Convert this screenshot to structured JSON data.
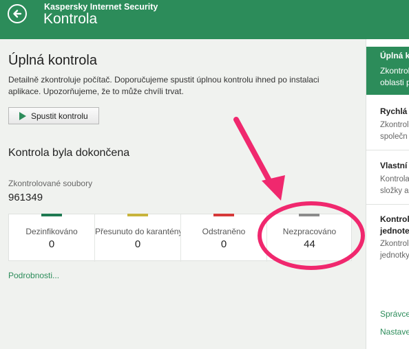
{
  "header": {
    "app_name": "Kaspersky Internet Security",
    "title": "Kontrola"
  },
  "main": {
    "heading": "Úplná kontrola",
    "description": "Detailně zkontroluje počítač. Doporučujeme spustit úplnou kontrolu ihned po instalaci aplikace. Upozorňujeme, že to může chvíli trvat.",
    "run_button": "Spustit kontrolu",
    "status_heading": "Kontrola byla dokončena",
    "files_label": "Zkontrolované soubory",
    "files_value": "961349",
    "stats": [
      {
        "label": "Dezinfikováno",
        "value": "0",
        "color": "#1f7a52"
      },
      {
        "label": "Přesunuto do karantény",
        "value": "0",
        "color": "#c8b43c"
      },
      {
        "label": "Odstraněno",
        "value": "0",
        "color": "#d63a3a"
      },
      {
        "label": "Nezpracováno",
        "value": "44",
        "color": "#8c8c8c"
      }
    ],
    "details_link": "Podrobnosti..."
  },
  "sidebar": {
    "active": {
      "title": "Úplná k",
      "desc_line1": "Zkontrol",
      "desc_line2": "oblasti p"
    },
    "items": [
      {
        "title": "Rychlá k",
        "desc_line1": "Zkontrol",
        "desc_line2": "společn"
      },
      {
        "title": "Vlastní k",
        "desc_line1": "Kontrola",
        "desc_line2": "složky a"
      },
      {
        "title_line1": "Kontrola",
        "title_line2": "jednote",
        "desc_line1": "Zkontrol",
        "desc_line2": "jednotky"
      }
    ],
    "links": [
      "Správce",
      "Nastave"
    ]
  },
  "colors": {
    "accent": "#2c8c5a",
    "annotation": "#f0286e"
  }
}
